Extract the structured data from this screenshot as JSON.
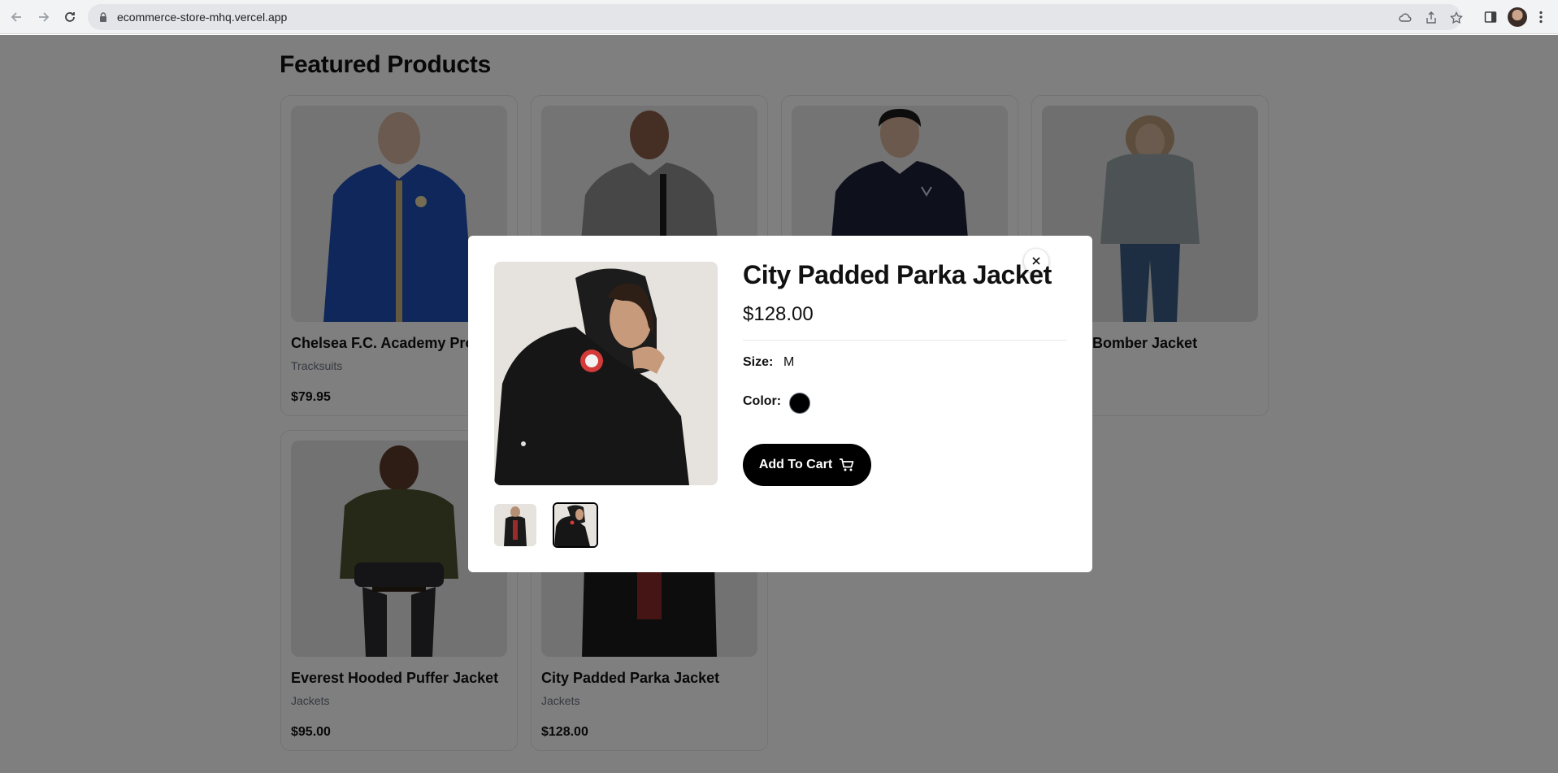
{
  "browser": {
    "url": "ecommerce-store-mhq.vercel.app"
  },
  "page": {
    "section_title": "Featured Products",
    "products": [
      {
        "name": "Chelsea F.C. Academy Pro",
        "category": "Tracksuits",
        "price": "$79.95"
      },
      {
        "name": "Bomber Jacket",
        "category": "",
        "price": ""
      },
      {
        "name": "Everest Hooded Puffer Jacket",
        "category": "Jackets",
        "price": "$95.00"
      },
      {
        "name": "City Padded Parka Jacket",
        "category": "Jackets",
        "price": "$128.00"
      }
    ]
  },
  "modal": {
    "title": "City Padded Parka Jacket",
    "price": "$128.00",
    "size_label": "Size:",
    "size_value": "M",
    "color_label": "Color:",
    "color_value": "#000000",
    "add_to_cart_label": "Add To Cart",
    "selected_thumbnail": 2
  },
  "colors": {
    "overlay": "rgba(0,0,0,0.5)",
    "button": "#000000"
  }
}
